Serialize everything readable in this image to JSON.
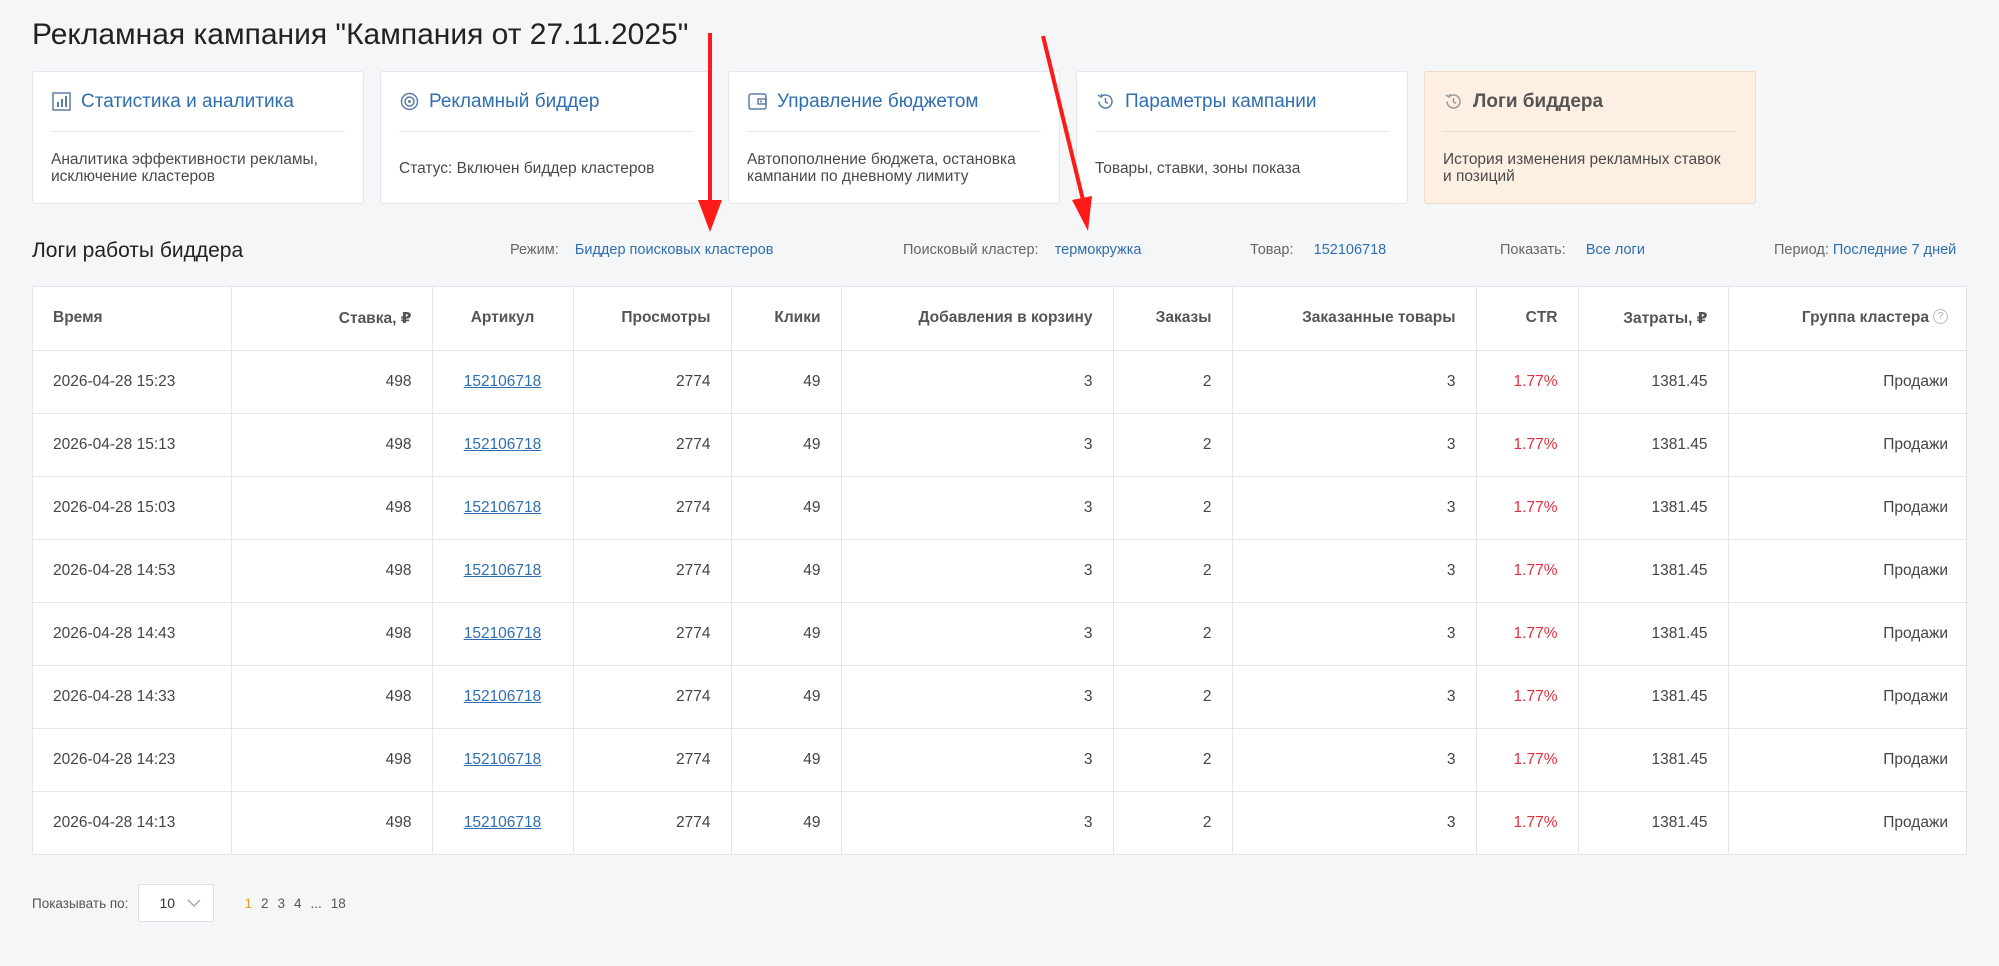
{
  "page_title": "Рекламная кампания \"Кампания от 27.11.2025\"",
  "cards": [
    {
      "title": "Статистика и аналитика",
      "desc_1": "Аналитика эффективности рекламы,",
      "desc_2": "исключение кластеров",
      "icon": "chart-icon"
    },
    {
      "title": "Рекламный биддер",
      "desc_1": "Статус:  Включен биддер кластеров",
      "desc_2": "",
      "icon": "target-icon"
    },
    {
      "title": "Управление бюджетом",
      "desc_1": "Автопополнение бюджета, остановка",
      "desc_2": "кампании по дневному лимиту",
      "icon": "wallet-icon"
    },
    {
      "title": "Параметры кампании",
      "desc_1": "Товары, ставки, зоны показа",
      "desc_2": "",
      "icon": "history-icon"
    },
    {
      "title": "Логи биддера",
      "desc_1": "История изменения рекламных ставок",
      "desc_2": "и позиций",
      "icon": "history-icon"
    }
  ],
  "section": {
    "title": "Логи работы биддера",
    "mode_label": "Режим:",
    "mode_value": "Биддер поисковых кластеров",
    "cluster_label": "Поисковый кластер:",
    "cluster_value": "термокружка",
    "product_label": "Товар:",
    "product_value": "152106718",
    "show_label": "Показать:",
    "show_value": "Все логи",
    "period_label": "Период:",
    "period_value": "Последние 7 дней"
  },
  "table": {
    "headers": [
      "Время",
      "Ставка, ₽",
      "Артикул",
      "Просмотры",
      "Клики",
      "Добавления в корзину",
      "Заказы",
      "Заказанные товары",
      "CTR",
      "Затраты, ₽",
      "Группа кластера"
    ],
    "help_icon": "?",
    "rows": [
      [
        "2026-04-28 15:23",
        "498",
        "152106718",
        "2774",
        "49",
        "3",
        "2",
        "3",
        "1.77%",
        "1381.45",
        "Продажи"
      ],
      [
        "2026-04-28 15:13",
        "498",
        "152106718",
        "2774",
        "49",
        "3",
        "2",
        "3",
        "1.77%",
        "1381.45",
        "Продажи"
      ],
      [
        "2026-04-28 15:03",
        "498",
        "152106718",
        "2774",
        "49",
        "3",
        "2",
        "3",
        "1.77%",
        "1381.45",
        "Продажи"
      ],
      [
        "2026-04-28 14:53",
        "498",
        "152106718",
        "2774",
        "49",
        "3",
        "2",
        "3",
        "1.77%",
        "1381.45",
        "Продажи"
      ],
      [
        "2026-04-28 14:43",
        "498",
        "152106718",
        "2774",
        "49",
        "3",
        "2",
        "3",
        "1.77%",
        "1381.45",
        "Продажи"
      ],
      [
        "2026-04-28 14:33",
        "498",
        "152106718",
        "2774",
        "49",
        "3",
        "2",
        "3",
        "1.77%",
        "1381.45",
        "Продажи"
      ],
      [
        "2026-04-28 14:23",
        "498",
        "152106718",
        "2774",
        "49",
        "3",
        "2",
        "3",
        "1.77%",
        "1381.45",
        "Продажи"
      ],
      [
        "2026-04-28 14:13",
        "498",
        "152106718",
        "2774",
        "49",
        "3",
        "2",
        "3",
        "1.77%",
        "1381.45",
        "Продажи"
      ]
    ]
  },
  "pager": {
    "per_page_label": "Показывать по:",
    "per_page_value": "10",
    "pages": [
      "1",
      "2",
      "3",
      "4",
      "...",
      "18"
    ],
    "current_page": "1"
  },
  "colors": {
    "link": "#2f6eb0",
    "ctr": "#e0303e",
    "active_card_bg": "#fdf0e3",
    "current_page": "#f09a2a",
    "annotation_arrow": "#ff1a1a"
  }
}
